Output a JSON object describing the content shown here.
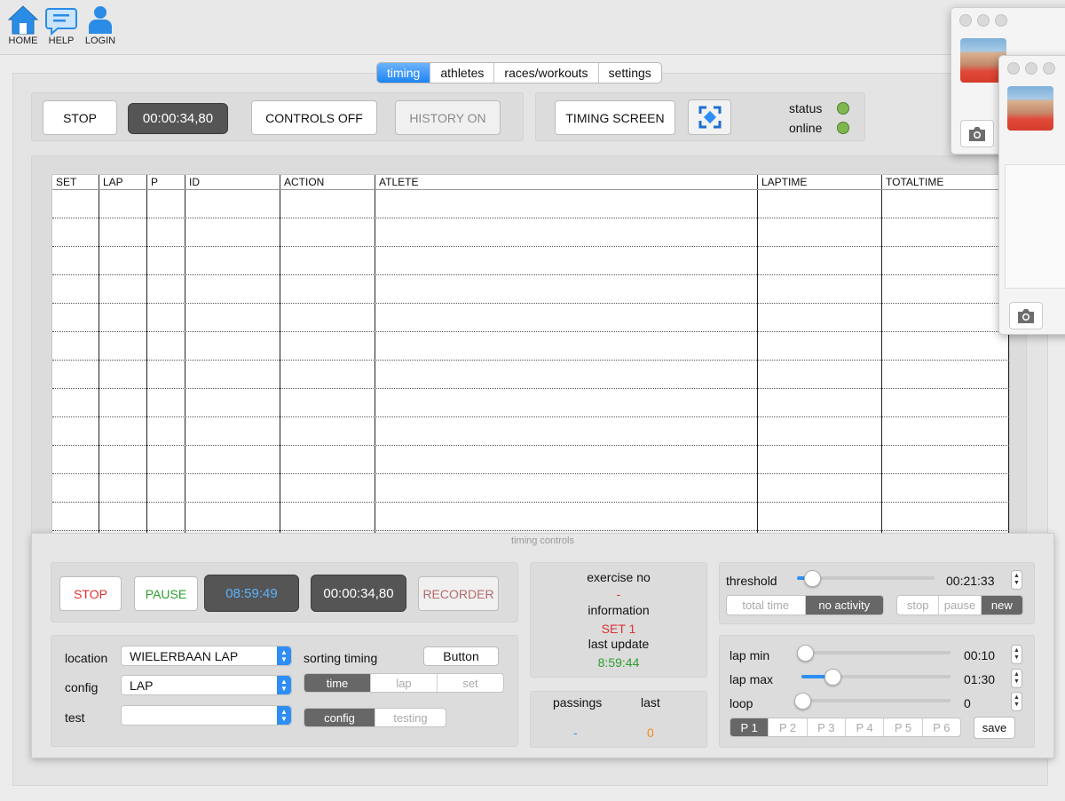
{
  "nav": [
    {
      "label": "HOME",
      "icon": "home-icon"
    },
    {
      "label": "HELP",
      "icon": "help-chat-icon"
    },
    {
      "label": "LOGIN",
      "icon": "user-icon"
    }
  ],
  "tabs": [
    "timing",
    "athletes",
    "races/workouts",
    "settings"
  ],
  "toolbar": {
    "stop_label": "STOP",
    "clock": "00:00:34,80",
    "controls_label": "CONTROLS OFF",
    "history_label": "HISTORY ON",
    "timing_screen_label": "TIMING SCREEN",
    "status_label": "status",
    "online_label": "online",
    "status_color": "#7fb74f"
  },
  "table": {
    "columns": [
      "SET",
      "LAP",
      "P",
      "ID",
      "ACTION",
      "ATLETE",
      "LAPTIME",
      "TOTALTIME"
    ]
  },
  "controls": {
    "title": "timing controls",
    "stop_label": "STOP",
    "pause_label": "PAUSE",
    "clock_time": "08:59:49",
    "elapsed": "00:00:34,80",
    "recorder_label": "RECORDER",
    "location_label": "location",
    "location_value": "WIELERBAAN LAP",
    "config_label": "config",
    "config_value": "LAP",
    "test_label": "test",
    "test_value": "",
    "sorting_label": "sorting timing",
    "button_label": "Button",
    "sort_options": [
      "time",
      "lap",
      "set"
    ],
    "mode_options": [
      "config",
      "testing"
    ]
  },
  "info": {
    "exercise_label": "exercise no",
    "exercise_value": "-",
    "information_label": "information",
    "set_value": "SET 1",
    "last_update_label": "last update",
    "last_update_value": "8:59:44",
    "passings_label": "passings",
    "last_label": "last",
    "passings_value": "-",
    "last_value": "0"
  },
  "threshold": {
    "label": "threshold",
    "value": "00:21:33",
    "level": 0.1,
    "options": [
      "total time",
      "no activity"
    ],
    "actions": [
      "stop",
      "pause",
      "new"
    ]
  },
  "laps": {
    "min_label": "lap min",
    "min_value": "00:10",
    "min_level": 0.02,
    "max_label": "lap max",
    "max_value": "01:30",
    "max_level": 0.2,
    "loop_label": "loop",
    "loop_value": "0",
    "loop_level": 0.0,
    "presets": [
      "P 1",
      "P 2",
      "P 3",
      "P 4",
      "P 5",
      "P 6"
    ],
    "save_label": "save"
  }
}
